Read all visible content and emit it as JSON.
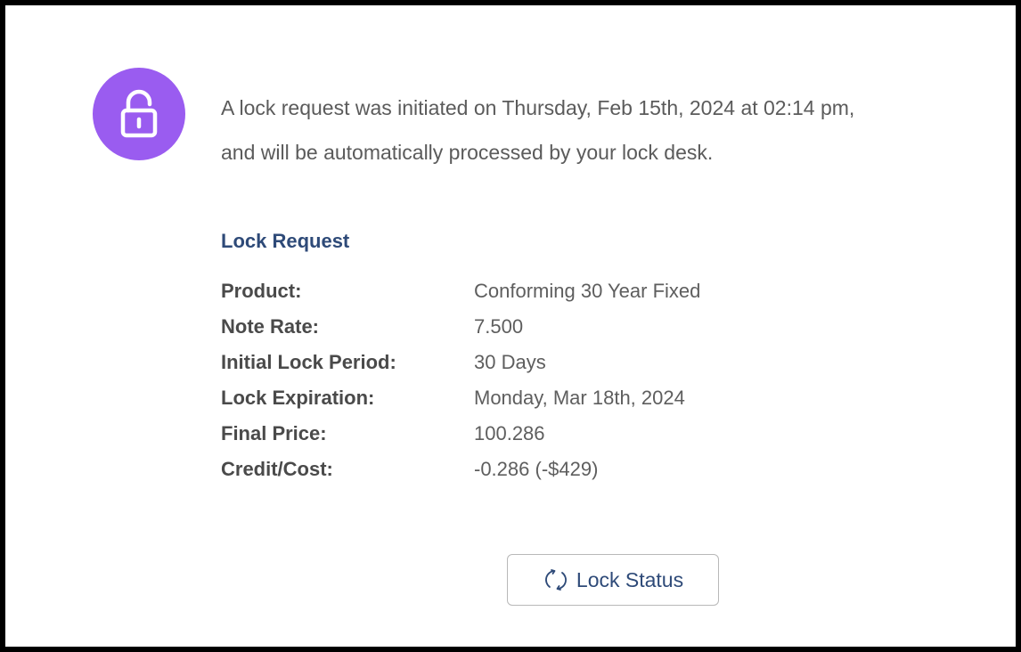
{
  "notice": {
    "icon": "unlock-icon",
    "accent_color": "#9a5cf0",
    "line1": "A lock request was initiated on Thursday, Feb 15th, 2024 at 02:14 pm,",
    "line2": "and will be automatically processed by your lock desk."
  },
  "lock_request": {
    "title": "Lock Request",
    "fields": [
      {
        "label": "Product:",
        "value": "Conforming 30 Year Fixed"
      },
      {
        "label": "Note Rate:",
        "value": "7.500"
      },
      {
        "label": "Initial Lock Period:",
        "value": "30 Days"
      },
      {
        "label": "Lock Expiration:",
        "value": "Monday, Mar 18th, 2024"
      },
      {
        "label": "Final Price:",
        "value": "100.286"
      },
      {
        "label": "Credit/Cost:",
        "value": "-0.286 (-$429)"
      }
    ]
  },
  "actions": {
    "lock_status_label": "Lock Status",
    "lock_status_icon": "refresh-icon",
    "title_color": "#2e4a78"
  }
}
